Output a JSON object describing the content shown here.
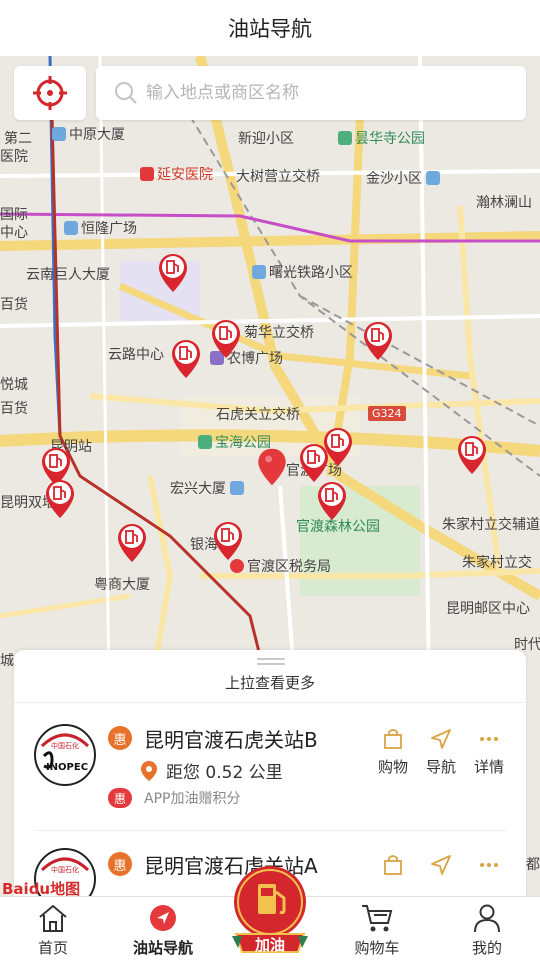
{
  "header": {
    "title": "油站导航"
  },
  "search": {
    "placeholder": "输入地点或商区名称"
  },
  "map": {
    "labels": [
      {
        "text": "中原大厦",
        "type": "poi"
      },
      {
        "text": "新迎小区",
        "type": "normal"
      },
      {
        "text": "昙华寺公园",
        "type": "poi"
      },
      {
        "text": "延安医院",
        "type": "hospital"
      },
      {
        "text": "大树营立交桥",
        "type": "normal"
      },
      {
        "text": "金沙小区",
        "type": "normal"
      },
      {
        "text": "瀚林澜山",
        "type": "normal"
      },
      {
        "text": "恒隆广场",
        "type": "normal"
      },
      {
        "text": "曙光铁路小区",
        "type": "normal"
      },
      {
        "text": "云南巨人大厦",
        "type": "normal"
      },
      {
        "text": "菊华立交桥",
        "type": "normal"
      },
      {
        "text": "云路中心",
        "type": "normal"
      },
      {
        "text": "农博广场",
        "type": "normal"
      },
      {
        "text": "石虎关立交桥",
        "type": "normal"
      },
      {
        "text": "G324",
        "type": "road"
      },
      {
        "text": "宝海公园",
        "type": "park"
      },
      {
        "text": "昆明站",
        "type": "normal"
      },
      {
        "text": "官渡广场",
        "type": "normal"
      },
      {
        "text": "宏兴大厦",
        "type": "normal"
      },
      {
        "text": "官渡森林公园",
        "type": "park"
      },
      {
        "text": "朱家村立交辅道",
        "type": "normal"
      },
      {
        "text": "银海御",
        "type": "normal"
      },
      {
        "text": "官渡区税务局",
        "type": "normal"
      },
      {
        "text": "朱家村立交",
        "type": "normal"
      },
      {
        "text": "粤商大厦",
        "type": "normal"
      },
      {
        "text": "昆明邮区中心",
        "type": "normal"
      },
      {
        "text": "时代",
        "type": "normal"
      },
      {
        "text": "第二",
        "type": "normal"
      },
      {
        "text": "医院",
        "type": "normal"
      },
      {
        "text": "国际",
        "type": "normal"
      },
      {
        "text": "中心",
        "type": "normal"
      },
      {
        "text": "百货",
        "type": "normal"
      },
      {
        "text": "悦城",
        "type": "normal"
      },
      {
        "text": "百货",
        "type": "normal"
      },
      {
        "text": "昆明双塔",
        "type": "normal"
      },
      {
        "text": "城",
        "type": "normal"
      },
      {
        "text": "都",
        "type": "normal"
      }
    ]
  },
  "panel": {
    "pull_text": "上拉查看更多",
    "stations": [
      {
        "name": "昆明官渡石虎关站B",
        "badge": "惠",
        "distance": "距您 0.52 公里",
        "promo_badge": "惠",
        "promo": "APP加油赠积分"
      },
      {
        "name": "昆明官渡石虎关站A",
        "badge": "惠"
      }
    ],
    "actions": {
      "shop": "购物",
      "navigate": "导航",
      "details": "详情"
    }
  },
  "tabbar": {
    "items": [
      {
        "label": "首页",
        "icon": "home-icon"
      },
      {
        "label": "油站导航",
        "icon": "navigation-icon"
      },
      {
        "label": "加油",
        "icon": "fuel-pump-icon"
      },
      {
        "label": "购物车",
        "icon": "cart-icon"
      },
      {
        "label": "我的",
        "icon": "user-icon"
      }
    ]
  },
  "map_logo": {
    "text": "Baidu地图"
  },
  "colors": {
    "accent": "#e4393c",
    "orange": "#e8722c",
    "gold": "#d9a441",
    "green": "#2e8b57"
  }
}
